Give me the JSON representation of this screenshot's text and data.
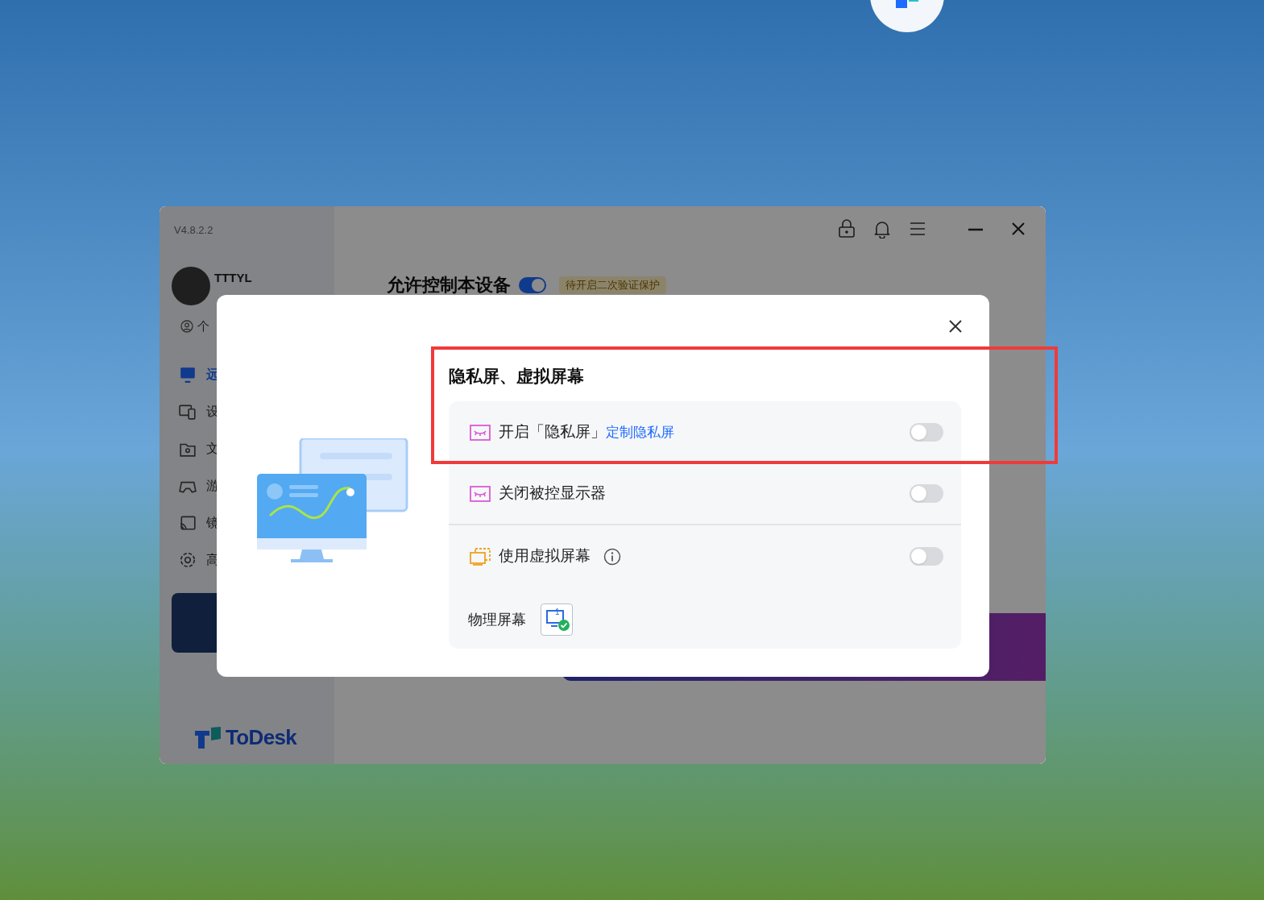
{
  "app_window": {
    "version": "V4.8.2.2",
    "user": {
      "name": "TTTYL",
      "profile_label": "个"
    },
    "sidebar": {
      "items": [
        {
          "label": "远",
          "selected": true
        },
        {
          "label": "设",
          "selected": false
        },
        {
          "label": "文",
          "selected": false
        },
        {
          "label": "游",
          "selected": false
        },
        {
          "label": "镜",
          "selected": false
        },
        {
          "label": "高",
          "selected": false
        }
      ]
    },
    "main": {
      "title": "允许控制本设备",
      "allow_control_on": true,
      "badge": "待开启二次验证保护"
    },
    "brand": "ToDesk"
  },
  "dialog": {
    "title": "隐私屏、虚拟屏幕",
    "rows": [
      {
        "kind": "privacy",
        "label": "开启「隐私屏」",
        "link": "定制隐私屏",
        "on": false
      },
      {
        "kind": "privacy",
        "label": "关闭被控显示器",
        "on": false
      },
      {
        "kind": "virtual",
        "label": "使用虚拟屏幕",
        "info": true,
        "on": false
      }
    ],
    "physical_screen": {
      "label": "物理屏幕",
      "number": "1",
      "selected": true
    }
  }
}
